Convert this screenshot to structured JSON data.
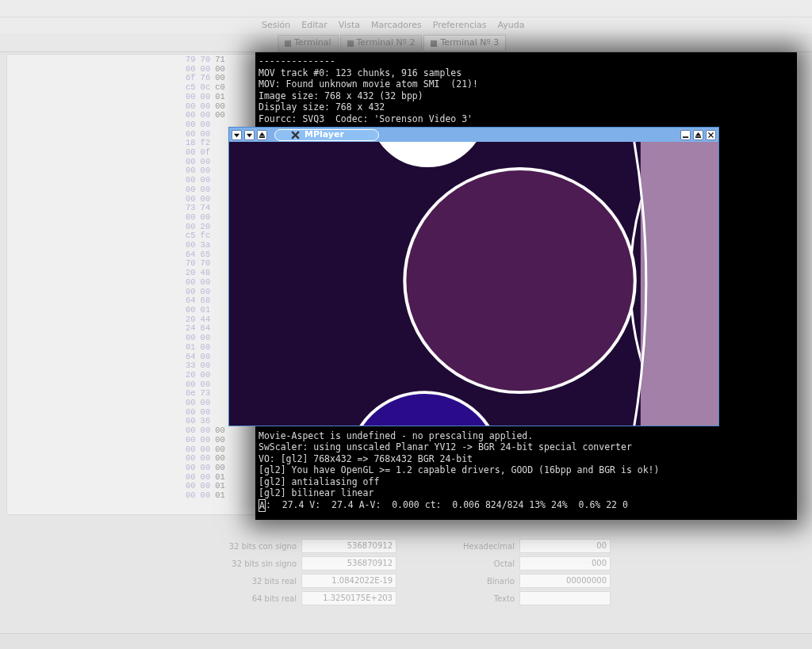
{
  "menu": [
    "Sesión",
    "Editar",
    "Vista",
    "Marcadores",
    "Preferencias",
    "Ayuda"
  ],
  "tabs": [
    {
      "label": "Terminal",
      "selected": false
    },
    {
      "label": "Terminal Nº 2",
      "selected": false
    },
    {
      "label": "Terminal Nº 3",
      "selected": true
    }
  ],
  "hex_rows": [
    [
      "79",
      "70",
      "71"
    ],
    [
      "00",
      "00",
      "00"
    ],
    [
      "6f",
      "76",
      "00"
    ],
    [
      "c5",
      "0c",
      "c0"
    ],
    [
      "00",
      "00",
      "01"
    ],
    [
      "00",
      "00",
      "00"
    ],
    [
      "00",
      "00",
      "00"
    ],
    [
      "00",
      "00"
    ],
    [
      "00",
      "00"
    ],
    [
      "18",
      "f2"
    ],
    [
      "00",
      "0f"
    ],
    [
      "00",
      "00"
    ],
    [
      "00",
      "00"
    ],
    [
      "00",
      "00"
    ],
    [
      "00",
      "00"
    ],
    [
      "00",
      "00"
    ],
    [
      "73",
      "74"
    ],
    [
      "00",
      "00"
    ],
    [
      "00",
      "20"
    ],
    [
      "c5",
      "fc"
    ],
    [
      "00",
      "3a"
    ],
    [
      "64",
      "65"
    ],
    [
      "70",
      "70"
    ],
    [
      "20",
      "48"
    ],
    [
      "00",
      "00"
    ],
    [
      "00",
      "00"
    ],
    [
      "64",
      "68"
    ],
    [
      "00",
      "01"
    ],
    [
      "20",
      "44"
    ],
    [
      "24",
      "64"
    ],
    [
      "00",
      "00"
    ],
    [
      "01",
      "00"
    ],
    [
      "64",
      "00"
    ],
    [
      "33",
      "00"
    ],
    [
      "20",
      "00"
    ],
    [
      "00",
      "00"
    ],
    [
      "6e",
      "73"
    ],
    [
      "00",
      "00"
    ],
    [
      "00",
      "00"
    ],
    [
      "00",
      "36"
    ],
    [
      "00",
      "00",
      "00"
    ],
    [
      "00",
      "00",
      "00"
    ],
    [
      "00",
      "00",
      "00"
    ],
    [
      "00",
      "00",
      "00"
    ],
    [
      "00",
      "00",
      "00"
    ],
    [
      "00",
      "00",
      "01"
    ],
    [
      "00",
      "00",
      "01"
    ],
    [
      "00",
      "00",
      "01"
    ]
  ],
  "terminal": {
    "top_lines": [
      "--------------",
      "MOV track #0: 123 chunks, 916 samples",
      "MOV: Found unknown movie atom SMI  (21)!",
      "Image size: 768 x 432 (32 bpp)",
      "Display size: 768 x 432",
      "Fourcc: SVQ3  Codec: 'Sorenson Video 3'"
    ],
    "bottom_lines": [
      "Movie-Aspect is undefined - no prescaling applied.",
      "SwScaler: using unscaled Planar YV12 -> BGR 24-bit special converter",
      "VO: [gl2] 768x432 => 768x432 BGR 24-bit",
      "[gl2] You have OpenGL >= 1.2 capable drivers, GOOD (16bpp and BGR is ok!)",
      "[gl2] antialiasing off",
      "[gl2] bilinear linear"
    ],
    "status_line": {
      "cursor": "A",
      "rest": ":  27.4 V:  27.4 A-V:  0.000 ct:  0.006 824/824 13% 24%  0.6% 22 0"
    }
  },
  "player": {
    "title": "MPlayer"
  },
  "values_left": [
    {
      "label": "32 bits con signo",
      "value": "536870912"
    },
    {
      "label": "32 bits sin signo",
      "value": "536870912"
    },
    {
      "label": "32 bits real",
      "value": "1.0842022E-19"
    },
    {
      "label": "64 bits real",
      "value": "1.3250175E+203"
    }
  ],
  "values_right": [
    {
      "label": "Hexadecimal",
      "value": "00"
    },
    {
      "label": "Octal",
      "value": "000"
    },
    {
      "label": "Binario",
      "value": "00000000"
    },
    {
      "label": "Texto"
    }
  ]
}
